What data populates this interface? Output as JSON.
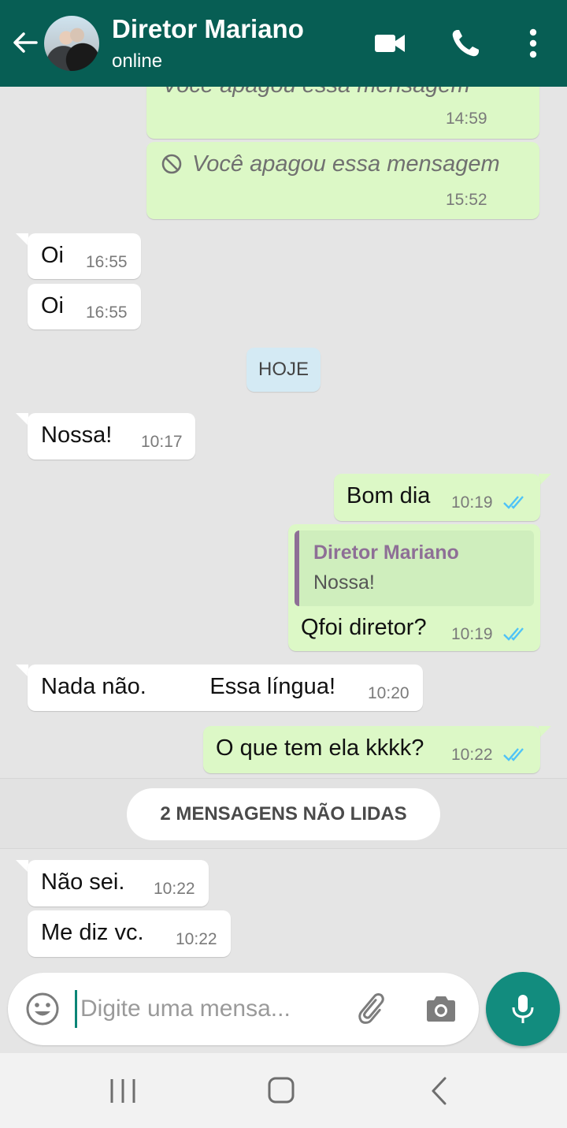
{
  "header": {
    "contact_name": "Diretor Mariano",
    "status": "online",
    "color": "#075e54"
  },
  "icons": {
    "back": "arrow-left",
    "video": "video-camera",
    "call": "phone",
    "menu": "more-vertical",
    "emoji": "smiley",
    "attach": "paperclip",
    "camera": "camera",
    "mic": "microphone"
  },
  "messages": [
    {
      "direction": "out",
      "text": "Você apagou essa mensagem",
      "time": "14:59",
      "deleted": true,
      "partial": true
    },
    {
      "direction": "out",
      "text": "Você apagou essa mensagem",
      "time": "15:52",
      "deleted": true
    },
    {
      "direction": "in",
      "text": "Oi",
      "time": "16:55"
    },
    {
      "direction": "in",
      "text": "Oi",
      "time": "16:55"
    },
    {
      "direction": "in",
      "text": "Nossa!",
      "time": "10:17"
    },
    {
      "direction": "out",
      "text": "Bom dia",
      "time": "10:19",
      "read": true
    },
    {
      "direction": "out",
      "text": "Qfoi diretor?",
      "time": "10:19",
      "read": true,
      "quote": {
        "author": "Diretor Mariano",
        "text": "Nossa!"
      }
    },
    {
      "direction": "in",
      "text": "Nada não.          Essa língua!",
      "time": "10:20"
    },
    {
      "direction": "out",
      "text": "O que tem ela kkkk?",
      "time": "10:22",
      "read": true
    },
    {
      "direction": "in",
      "text": "Não sei.",
      "time": "10:22"
    },
    {
      "direction": "in",
      "text": "Me diz vc.",
      "time": "10:22"
    }
  ],
  "date_separator": "HOJE",
  "unread_label": "2 MENSAGENS NÃO LIDAS",
  "composer": {
    "placeholder": "Digite uma mensa...",
    "value": ""
  },
  "colors": {
    "outgoing_bubble": "#dcf8c6",
    "incoming_bubble": "#ffffff",
    "read_ticks": "#4fc3f7",
    "mic_button": "#128c7e",
    "quote_author": "#8e6f96"
  }
}
